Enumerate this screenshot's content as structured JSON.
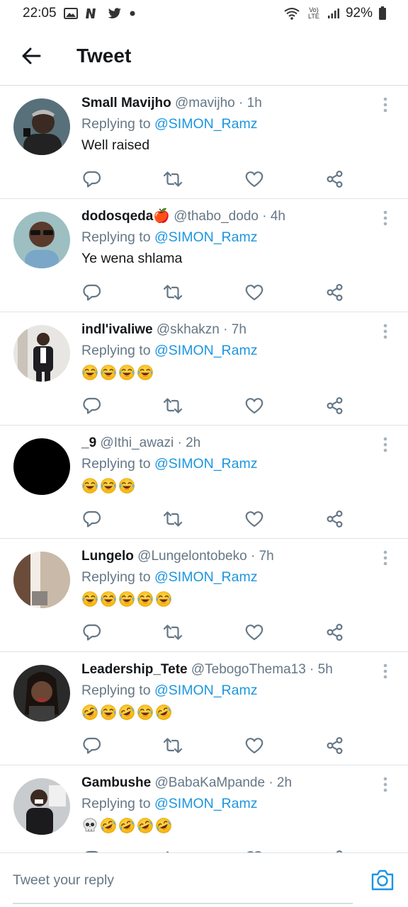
{
  "status_bar": {
    "time": "22:05",
    "battery": "92%",
    "network_label": "Vo) LTE"
  },
  "header": {
    "title": "Tweet"
  },
  "tweets": [
    {
      "name": "Small Mavijho",
      "handle": "@mavijho",
      "time": "· 1h",
      "replying_prefix": "Replying to ",
      "replying_to": "@SIMON_Ramz",
      "text": "Well raised"
    },
    {
      "name": "dodosqeda🍎",
      "handle": "@thabo_dodo",
      "time": "· 4h",
      "replying_prefix": "Replying to ",
      "replying_to": "@SIMON_Ramz",
      "text": "Ye wena shlama"
    },
    {
      "name": "indl'ivaliwe",
      "handle": "@skhakzn",
      "time": "· 7h",
      "replying_prefix": "Replying to ",
      "replying_to": "@SIMON_Ramz",
      "emojis": [
        "😂",
        "😂",
        "😂",
        "😂"
      ]
    },
    {
      "name": "_9",
      "handle": "@Ithi_awazi",
      "time": "· 2h",
      "replying_prefix": "Replying to ",
      "replying_to": "@SIMON_Ramz",
      "emojis": [
        "😂",
        "😂",
        "😂"
      ]
    },
    {
      "name": "Lungelo",
      "handle": "@Lungelontobeko",
      "time": "· 7h",
      "replying_prefix": "Replying to ",
      "replying_to": "@SIMON_Ramz",
      "emojis": [
        "😂",
        "😂",
        "😂",
        "😂",
        "😂"
      ]
    },
    {
      "name": "Leadership_Tete",
      "handle": "@TebogoThema13",
      "time": "· 5h",
      "replying_prefix": "Replying to ",
      "replying_to": "@SIMON_Ramz",
      "emojis": [
        "🤣",
        "😂",
        "🤣",
        "😂",
        "🤣"
      ]
    },
    {
      "name": "Gambushe",
      "handle": "@BabaKaMpande",
      "time": "· 2h",
      "replying_prefix": "Replying to ",
      "replying_to": "@SIMON_Ramz",
      "emojis": [
        "💀",
        "🤣",
        "🤣",
        "🤣",
        "🤣"
      ]
    }
  ],
  "reply_bar": {
    "placeholder": "Tweet your reply"
  },
  "colors": {
    "link": "#1b95e0",
    "secondary_text": "#657786",
    "icon_gray": "#657786",
    "icon_blue": "#1b95e0"
  },
  "icons": {
    "back": "arrow-left-icon",
    "reply": "reply-icon",
    "retweet": "retweet-icon",
    "like": "heart-icon",
    "share": "share-icon",
    "more": "more-vertical-icon",
    "camera": "camera-icon"
  }
}
